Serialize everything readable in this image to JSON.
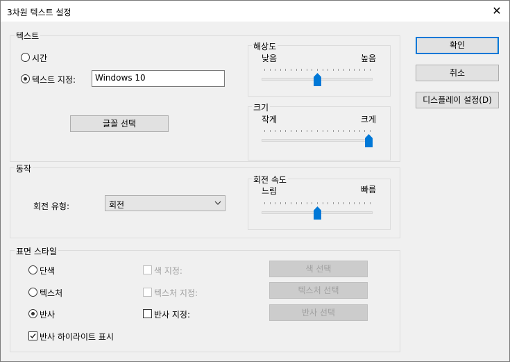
{
  "window": {
    "title": "3차원 텍스트 설정",
    "close_glyph": "✕"
  },
  "text_group": {
    "label": "텍스트",
    "radio_time": "시간",
    "radio_custom": "텍스트 지정:",
    "custom_value": "Windows 10",
    "font_button": "글꼴 선택",
    "resolution": {
      "label": "해상도",
      "low": "낮음",
      "high": "높음",
      "value": 0.5
    },
    "size": {
      "label": "크기",
      "small": "작게",
      "large": "크게",
      "value": 1.0
    }
  },
  "motion_group": {
    "label": "동작",
    "rotation_type_label": "회전 유형:",
    "rotation_type_value": "회전",
    "speed": {
      "label": "회전 속도",
      "slow": "느림",
      "fast": "빠름",
      "value": 0.5
    }
  },
  "surface_group": {
    "label": "표면 스타일",
    "solid": "단색",
    "texture": "텍스처",
    "reflection": "반사",
    "color_check": "색 지정:",
    "texture_check": "텍스처 지정:",
    "reflection_check": "반사 지정:",
    "color_button": "색 선택",
    "texture_button": "텍스처 선택",
    "reflection_button": "반사 선택",
    "highlight_check": "반사 하이라이트 표시"
  },
  "buttons": {
    "ok": "확인",
    "cancel": "취소",
    "display": "디스플레이 설정(D)"
  },
  "colors": {
    "accent": "#0078d7",
    "disabled_text": "#a0a0a0"
  }
}
